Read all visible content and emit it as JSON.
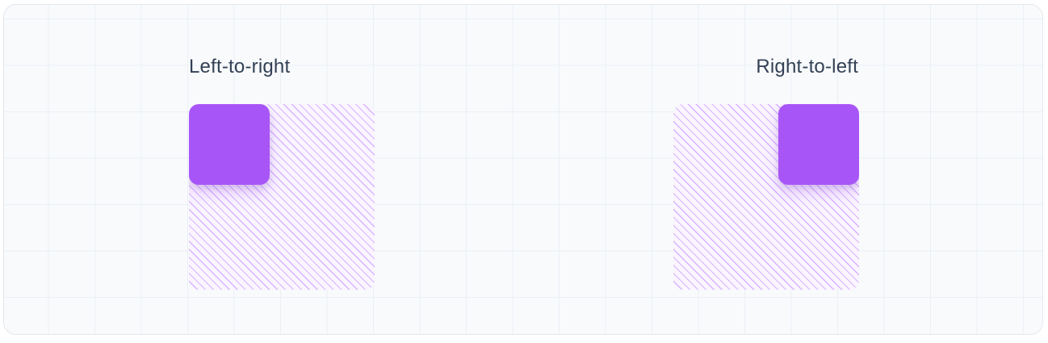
{
  "examples": [
    {
      "label": "Left-to-right",
      "direction": "ltr"
    },
    {
      "label": "Right-to-left",
      "direction": "rtl"
    }
  ],
  "colors": {
    "item": "#a855f7",
    "stripes": "#d8b4fe",
    "label_text": "#334155",
    "background": "#f8fafc"
  }
}
